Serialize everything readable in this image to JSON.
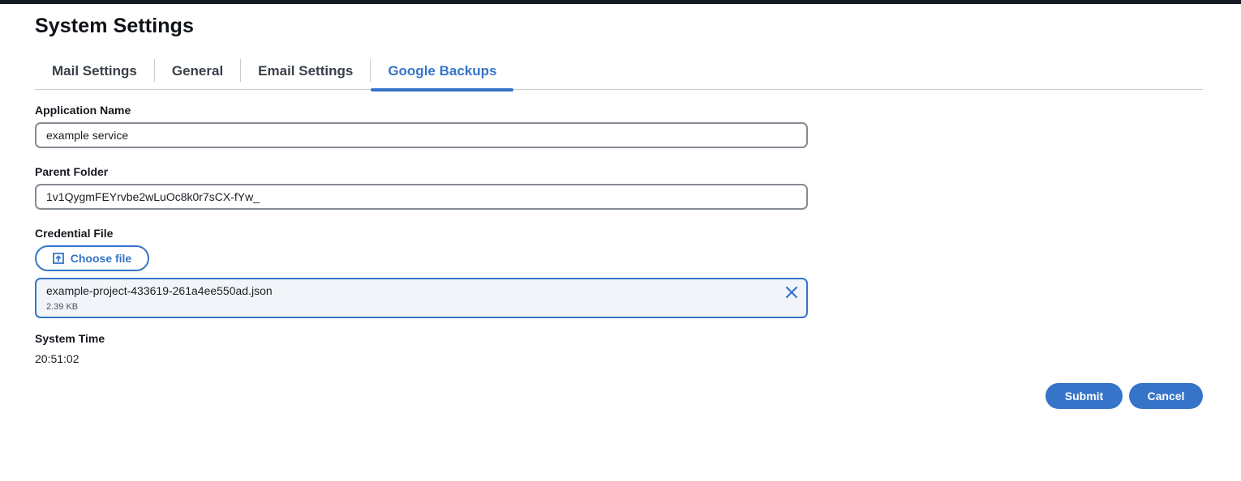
{
  "page": {
    "title": "System Settings"
  },
  "tabs": [
    {
      "label": "Mail Settings",
      "active": false
    },
    {
      "label": "General",
      "active": false
    },
    {
      "label": "Email Settings",
      "active": false
    },
    {
      "label": "Google Backups",
      "active": true
    }
  ],
  "form": {
    "application_name": {
      "label": "Application Name",
      "value": "example service"
    },
    "parent_folder": {
      "label": "Parent Folder",
      "value": "1v1QygmFEYrvbe2wLuOc8k0r7sCX-fYw_"
    },
    "credential_file": {
      "label": "Credential File",
      "choose_label": "Choose file",
      "choose_icon": "upload-icon",
      "file_name": "example-project-433619-261a4ee550ad.json",
      "file_size": "2.39 KB",
      "remove_icon": "close-icon"
    },
    "system_time": {
      "label": "System Time",
      "value": "20:51:02"
    }
  },
  "actions": {
    "submit_label": "Submit",
    "cancel_label": "Cancel"
  },
  "colors": {
    "accent": "#3574c8",
    "topbar": "#151a23",
    "border": "#858b93",
    "file_bg": "#f1f5fa"
  }
}
